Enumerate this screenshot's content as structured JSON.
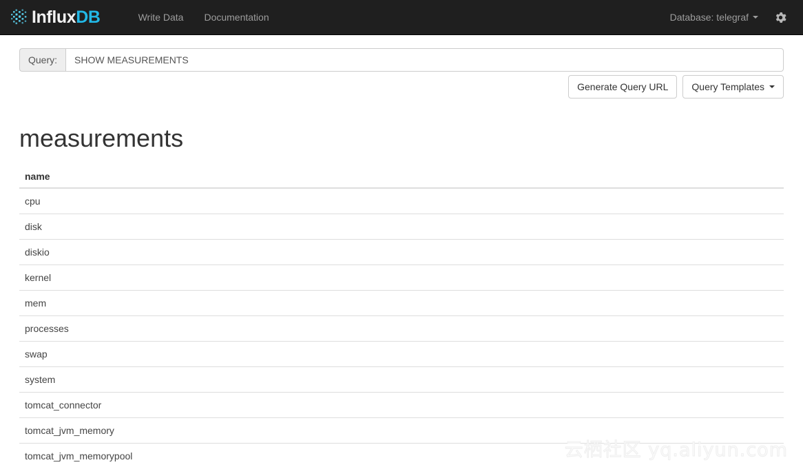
{
  "navbar": {
    "brand": {
      "primary": "Influx",
      "accent": "DB",
      "logo_icon": "influxdb-dot-cluster-logo"
    },
    "links": [
      {
        "label": "Write Data"
      },
      {
        "label": "Documentation"
      }
    ],
    "database_selector": {
      "label": "Database: telegraf"
    },
    "settings_icon": "gear-icon",
    "background_color": "#1f1f1f",
    "accent_color": "#22b8e6"
  },
  "query": {
    "addon_label": "Query:",
    "value": "SHOW MEASUREMENTS",
    "placeholder": "Enter query"
  },
  "actions": {
    "generate_url_label": "Generate Query URL",
    "templates_label": "Query Templates"
  },
  "results": {
    "title": "measurements",
    "columns": [
      "name"
    ],
    "rows": [
      [
        "cpu"
      ],
      [
        "disk"
      ],
      [
        "diskio"
      ],
      [
        "kernel"
      ],
      [
        "mem"
      ],
      [
        "processes"
      ],
      [
        "swap"
      ],
      [
        "system"
      ],
      [
        "tomcat_connector"
      ],
      [
        "tomcat_jvm_memory"
      ],
      [
        "tomcat_jvm_memorypool"
      ]
    ]
  },
  "watermark": {
    "text": "云栖社区 yq.aliyun.com"
  }
}
